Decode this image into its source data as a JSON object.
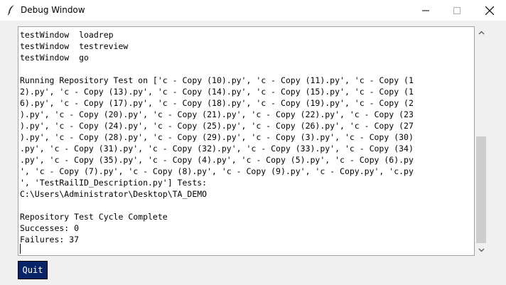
{
  "window": {
    "title": "Debug Window",
    "icon": "feather-icon",
    "controls": [
      "minimize-icon",
      "maximize-icon",
      "close-icon"
    ]
  },
  "debug_output": {
    "lines": [
      "testWindow  loadrep",
      "testWindow  testreview",
      "testWindow  go",
      "",
      "Running Repository Test on ['c - Copy (10).py', 'c - Copy (11).py', 'c - Copy (1",
      "2).py', 'c - Copy (13).py', 'c - Copy (14).py', 'c - Copy (15).py', 'c - Copy (1",
      "6).py', 'c - Copy (17).py', 'c - Copy (18).py', 'c - Copy (19).py', 'c - Copy (2",
      ").py', 'c - Copy (20).py', 'c - Copy (21).py', 'c - Copy (22).py', 'c - Copy (23",
      ").py', 'c - Copy (24).py', 'c - Copy (25).py', 'c - Copy (26).py', 'c - Copy (27",
      ").py', 'c - Copy (28).py', 'c - Copy (29).py', 'c - Copy (3).py', 'c - Copy (30)",
      ".py', 'c - Copy (31).py', 'c - Copy (32).py', 'c - Copy (33).py', 'c - Copy (34)",
      ".py', 'c - Copy (35).py', 'c - Copy (4).py', 'c - Copy (5).py', 'c - Copy (6).py",
      "', 'c - Copy (7).py', 'c - Copy (8).py', 'c - Copy (9).py', 'c - Copy.py', 'c.py",
      "', 'TestRailID_Description.py'] Tests:",
      "C:\\Users\\Administrator\\Desktop\\TA_DEMO",
      "",
      "Repository Test Cycle Complete",
      "Successes: 0",
      "Failures: 37"
    ]
  },
  "buttons": {
    "quit_label": "Quit"
  },
  "colors": {
    "quit_bg": "#0a246a",
    "scroll_thumb": "#cdcdcd"
  }
}
